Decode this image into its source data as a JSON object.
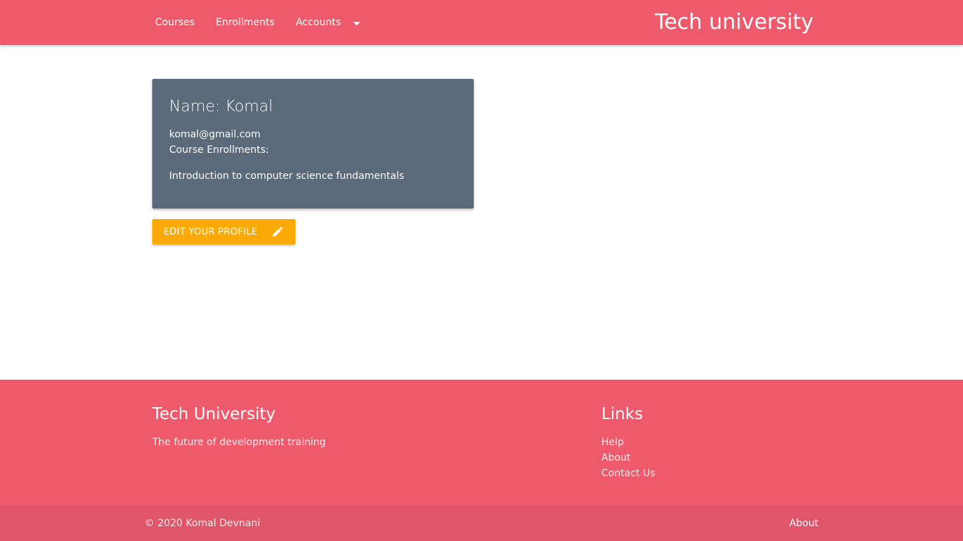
{
  "colors": {
    "primary": "#ee5a6c",
    "footer_bottom": "#df566a",
    "card": "#5a6a7b",
    "accent_button": "#fbaa08"
  },
  "nav": {
    "links": [
      "Courses",
      "Enrollments",
      "Accounts"
    ],
    "dropdown_icon": "caret-down-icon",
    "brand": "Tech university"
  },
  "profile": {
    "name": "Name: Komal",
    "email": "komal@gmail.com",
    "enrollments_label": "Course Enrollments:",
    "enrollments": [
      "Introduction to computer science fundamentals"
    ]
  },
  "edit_button": {
    "label": "EDIT YOUR PROFILE",
    "icon": "pencil-icon"
  },
  "footer": {
    "title": "Tech University",
    "tagline": "The future of development training",
    "links_heading": "Links",
    "links": [
      "Help",
      "About",
      "Contact Us"
    ],
    "copyright": "© 2020 Komal Devnani",
    "bottom_link": "About"
  }
}
